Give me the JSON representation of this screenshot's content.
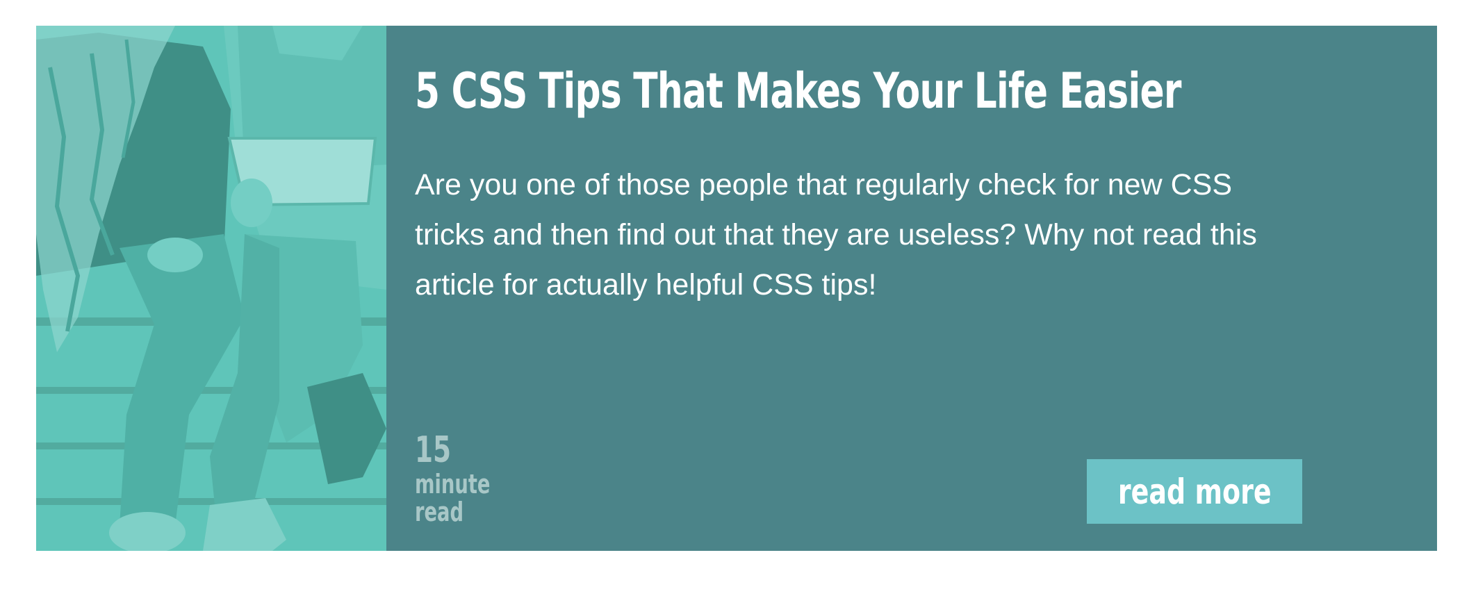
{
  "card": {
    "title": "5 CSS Tips That Makes Your Life Easier",
    "description": "Are you one of those people that regularly check for new CSS tricks and then find out that they are useless? Why not read this article for actually helpful CSS tips!",
    "read_time": {
      "value": "15",
      "unit_line1": "minute",
      "unit_line2": "read"
    },
    "read_more_label": "read more"
  },
  "colors": {
    "card_background": "#4b8489",
    "photo_tint": "#5ec4b8",
    "button_background": "#6cc2c6",
    "read_time_text": "#a8c7c7",
    "text": "#ffffff"
  },
  "icons": {
    "photo": "people-sitting-on-steps-image"
  }
}
